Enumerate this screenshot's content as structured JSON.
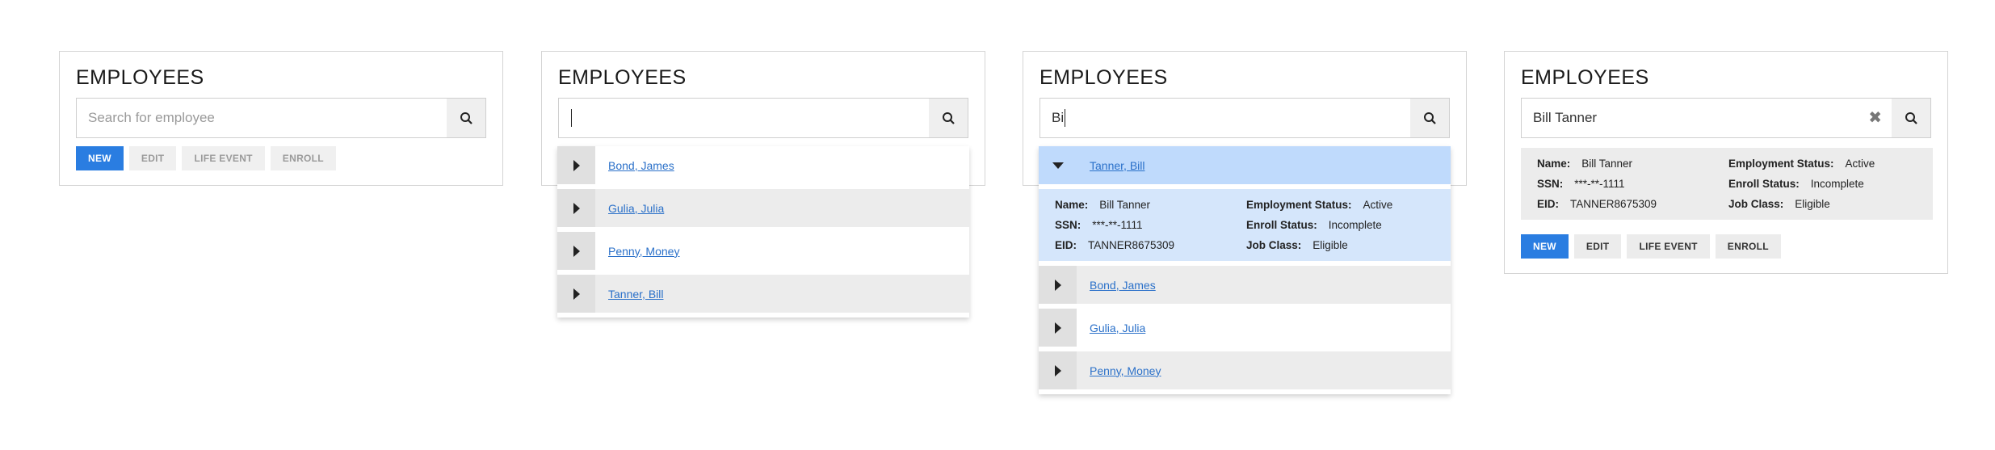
{
  "panels": [
    {
      "title": "EMPLOYEES",
      "search_placeholder": "Search for employee",
      "actions": [
        "NEW",
        "EDIT",
        "LIFE EVENT",
        "ENROLL"
      ]
    },
    {
      "title": "EMPLOYEES",
      "search_value": "",
      "results": [
        "Bond, James",
        "Gulia, Julia",
        "Penny, Money",
        "Tanner, Bill"
      ]
    },
    {
      "title": "EMPLOYEES",
      "search_value": "Bi",
      "selected": "Tanner, Bill",
      "details": {
        "name_label": "Name:",
        "name": "Bill Tanner",
        "ssn_label": "SSN:",
        "ssn": "***-**-1111",
        "eid_label": "EID:",
        "eid": "TANNER8675309",
        "employment_label": "Employment Status:",
        "employment": "Active",
        "enroll_label": "Enroll Status:",
        "enroll": "Incomplete",
        "job_label": "Job Class:",
        "job": "Eligible"
      },
      "results": [
        "Bond, James",
        "Gulia, Julia",
        "Penny, Money"
      ]
    },
    {
      "title": "EMPLOYEES",
      "search_value": "Bill Tanner",
      "details": {
        "name_label": "Name:",
        "name": "Bill Tanner",
        "ssn_label": "SSN:",
        "ssn": "***-**-1111",
        "eid_label": "EID:",
        "eid": "TANNER8675309",
        "employment_label": "Employment Status:",
        "employment": "Active",
        "enroll_label": "Enroll Status:",
        "enroll": "Incomplete",
        "job_label": "Job Class:",
        "job": "Eligible"
      },
      "actions": [
        "NEW",
        "EDIT",
        "LIFE EVENT",
        "ENROLL"
      ]
    }
  ],
  "colors": {
    "primary": "#2a7de1",
    "selected_row": "#bfdafc",
    "details_bg": "#d5e6fb",
    "link": "#2a70c9"
  },
  "icons": {
    "search": "search-icon",
    "clear": "clear-icon",
    "expand": "expand-arrow-icon",
    "collapse": "collapse-arrow-icon"
  }
}
